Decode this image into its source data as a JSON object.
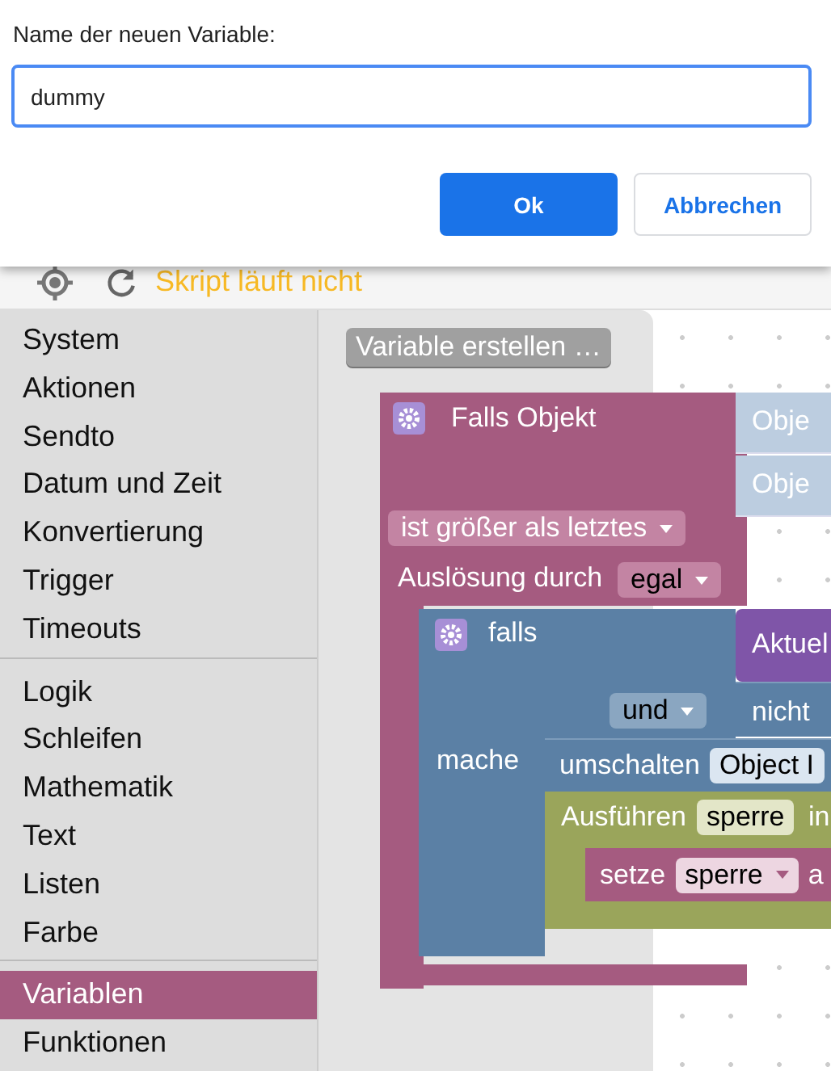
{
  "dialog": {
    "label": "Name der neuen Variable:",
    "input_value": "dummy",
    "buttons": [
      {
        "label": "Ok",
        "kind": "primary"
      },
      {
        "label": "Abbrechen",
        "kind": "secondary"
      }
    ]
  },
  "toolbar": {
    "status": "Skript läuft nicht"
  },
  "category_groups": [
    [
      {
        "label": "System",
        "selected": false
      },
      {
        "label": "Aktionen",
        "selected": false
      },
      {
        "label": "Sendto",
        "selected": false
      },
      {
        "label": "Datum und Zeit",
        "selected": false
      },
      {
        "label": "Konvertierung",
        "selected": false
      },
      {
        "label": "Trigger",
        "selected": false
      },
      {
        "label": "Timeouts",
        "selected": false
      }
    ],
    [
      {
        "label": "Logik",
        "selected": false
      },
      {
        "label": "Schleifen",
        "selected": false
      },
      {
        "label": "Mathematik",
        "selected": false
      },
      {
        "label": "Text",
        "selected": false
      },
      {
        "label": "Listen",
        "selected": false
      },
      {
        "label": "Farbe",
        "selected": false
      }
    ],
    [
      {
        "label": "Variablen",
        "selected": true
      },
      {
        "label": "Funktionen",
        "selected": false
      }
    ]
  ],
  "flyout": {
    "button": "Variable erstellen …"
  },
  "workspace": {
    "trigger": {
      "title": "Falls Objekt",
      "inputs": [
        "Obje",
        "Obje"
      ],
      "condition": "ist größer als letztes",
      "trigger_label": "Auslösung durch",
      "trigger_value": "egal"
    },
    "if_block": {
      "title": "falls",
      "operator": "und",
      "do_label": "mache",
      "inputs": [
        "Aktuel",
        "nicht"
      ]
    },
    "toggle": {
      "label": "umschalten",
      "field": "Object I"
    },
    "run": {
      "label": "Ausführen",
      "variable": "sperre",
      "suffix": "in"
    },
    "set": {
      "label": "setze",
      "variable": "sperre",
      "suffix": "a"
    }
  }
}
